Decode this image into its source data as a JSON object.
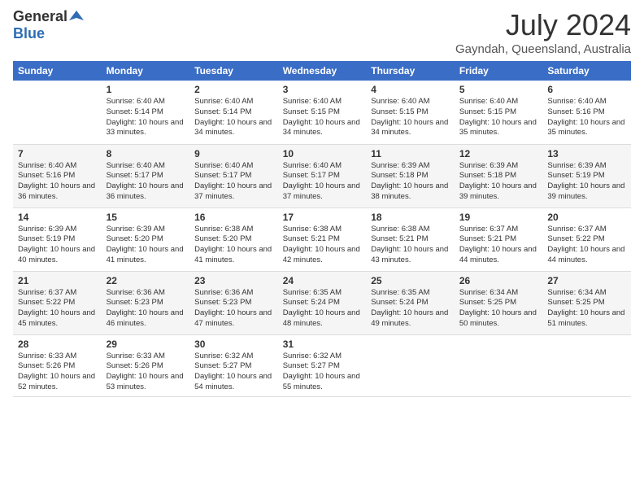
{
  "header": {
    "logo_general": "General",
    "logo_blue": "Blue",
    "month": "July 2024",
    "location": "Gayndah, Queensland, Australia"
  },
  "days_of_week": [
    "Sunday",
    "Monday",
    "Tuesday",
    "Wednesday",
    "Thursday",
    "Friday",
    "Saturday"
  ],
  "weeks": [
    [
      {
        "num": "",
        "info": ""
      },
      {
        "num": "1",
        "info": "Sunrise: 6:40 AM\nSunset: 5:14 PM\nDaylight: 10 hours\nand 33 minutes."
      },
      {
        "num": "2",
        "info": "Sunrise: 6:40 AM\nSunset: 5:14 PM\nDaylight: 10 hours\nand 34 minutes."
      },
      {
        "num": "3",
        "info": "Sunrise: 6:40 AM\nSunset: 5:15 PM\nDaylight: 10 hours\nand 34 minutes."
      },
      {
        "num": "4",
        "info": "Sunrise: 6:40 AM\nSunset: 5:15 PM\nDaylight: 10 hours\nand 34 minutes."
      },
      {
        "num": "5",
        "info": "Sunrise: 6:40 AM\nSunset: 5:15 PM\nDaylight: 10 hours\nand 35 minutes."
      },
      {
        "num": "6",
        "info": "Sunrise: 6:40 AM\nSunset: 5:16 PM\nDaylight: 10 hours\nand 35 minutes."
      }
    ],
    [
      {
        "num": "7",
        "info": "Sunrise: 6:40 AM\nSunset: 5:16 PM\nDaylight: 10 hours\nand 36 minutes."
      },
      {
        "num": "8",
        "info": "Sunrise: 6:40 AM\nSunset: 5:17 PM\nDaylight: 10 hours\nand 36 minutes."
      },
      {
        "num": "9",
        "info": "Sunrise: 6:40 AM\nSunset: 5:17 PM\nDaylight: 10 hours\nand 37 minutes."
      },
      {
        "num": "10",
        "info": "Sunrise: 6:40 AM\nSunset: 5:17 PM\nDaylight: 10 hours\nand 37 minutes."
      },
      {
        "num": "11",
        "info": "Sunrise: 6:39 AM\nSunset: 5:18 PM\nDaylight: 10 hours\nand 38 minutes."
      },
      {
        "num": "12",
        "info": "Sunrise: 6:39 AM\nSunset: 5:18 PM\nDaylight: 10 hours\nand 39 minutes."
      },
      {
        "num": "13",
        "info": "Sunrise: 6:39 AM\nSunset: 5:19 PM\nDaylight: 10 hours\nand 39 minutes."
      }
    ],
    [
      {
        "num": "14",
        "info": "Sunrise: 6:39 AM\nSunset: 5:19 PM\nDaylight: 10 hours\nand 40 minutes."
      },
      {
        "num": "15",
        "info": "Sunrise: 6:39 AM\nSunset: 5:20 PM\nDaylight: 10 hours\nand 41 minutes."
      },
      {
        "num": "16",
        "info": "Sunrise: 6:38 AM\nSunset: 5:20 PM\nDaylight: 10 hours\nand 41 minutes."
      },
      {
        "num": "17",
        "info": "Sunrise: 6:38 AM\nSunset: 5:21 PM\nDaylight: 10 hours\nand 42 minutes."
      },
      {
        "num": "18",
        "info": "Sunrise: 6:38 AM\nSunset: 5:21 PM\nDaylight: 10 hours\nand 43 minutes."
      },
      {
        "num": "19",
        "info": "Sunrise: 6:37 AM\nSunset: 5:21 PM\nDaylight: 10 hours\nand 44 minutes."
      },
      {
        "num": "20",
        "info": "Sunrise: 6:37 AM\nSunset: 5:22 PM\nDaylight: 10 hours\nand 44 minutes."
      }
    ],
    [
      {
        "num": "21",
        "info": "Sunrise: 6:37 AM\nSunset: 5:22 PM\nDaylight: 10 hours\nand 45 minutes."
      },
      {
        "num": "22",
        "info": "Sunrise: 6:36 AM\nSunset: 5:23 PM\nDaylight: 10 hours\nand 46 minutes."
      },
      {
        "num": "23",
        "info": "Sunrise: 6:36 AM\nSunset: 5:23 PM\nDaylight: 10 hours\nand 47 minutes."
      },
      {
        "num": "24",
        "info": "Sunrise: 6:35 AM\nSunset: 5:24 PM\nDaylight: 10 hours\nand 48 minutes."
      },
      {
        "num": "25",
        "info": "Sunrise: 6:35 AM\nSunset: 5:24 PM\nDaylight: 10 hours\nand 49 minutes."
      },
      {
        "num": "26",
        "info": "Sunrise: 6:34 AM\nSunset: 5:25 PM\nDaylight: 10 hours\nand 50 minutes."
      },
      {
        "num": "27",
        "info": "Sunrise: 6:34 AM\nSunset: 5:25 PM\nDaylight: 10 hours\nand 51 minutes."
      }
    ],
    [
      {
        "num": "28",
        "info": "Sunrise: 6:33 AM\nSunset: 5:26 PM\nDaylight: 10 hours\nand 52 minutes."
      },
      {
        "num": "29",
        "info": "Sunrise: 6:33 AM\nSunset: 5:26 PM\nDaylight: 10 hours\nand 53 minutes."
      },
      {
        "num": "30",
        "info": "Sunrise: 6:32 AM\nSunset: 5:27 PM\nDaylight: 10 hours\nand 54 minutes."
      },
      {
        "num": "31",
        "info": "Sunrise: 6:32 AM\nSunset: 5:27 PM\nDaylight: 10 hours\nand 55 minutes."
      },
      {
        "num": "",
        "info": ""
      },
      {
        "num": "",
        "info": ""
      },
      {
        "num": "",
        "info": ""
      }
    ]
  ]
}
